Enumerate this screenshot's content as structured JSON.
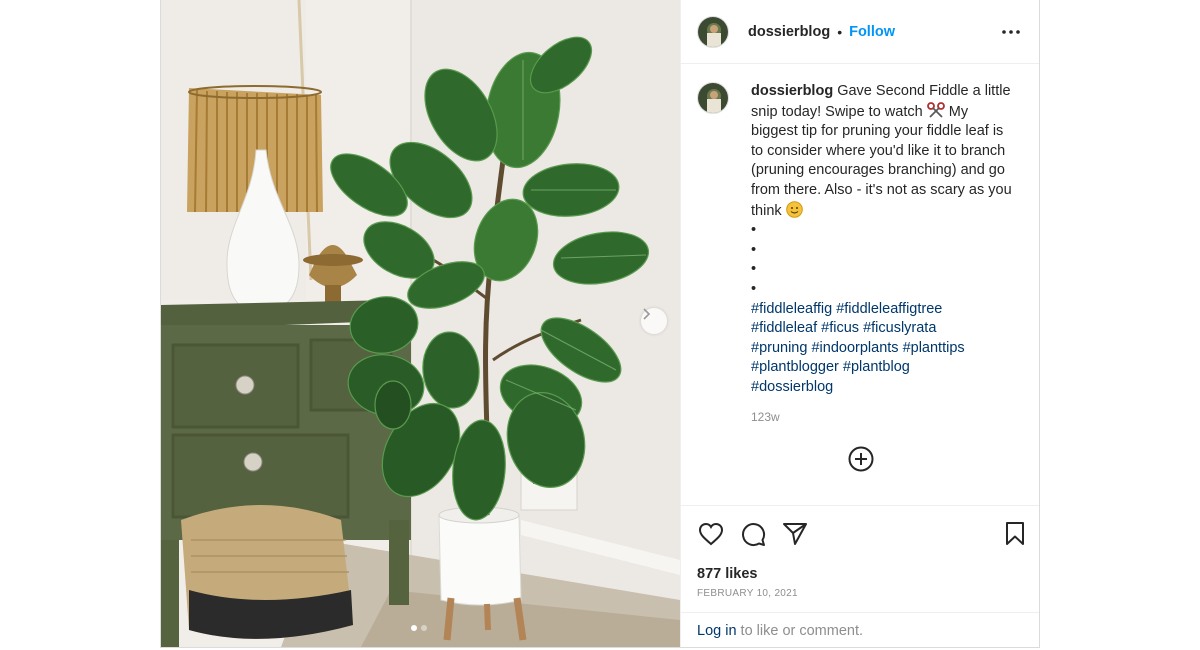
{
  "post": {
    "username": "dossierblog",
    "separator": "•",
    "follow_label": "Follow",
    "more_icon": "more-horizontal-icon",
    "caption": {
      "username": "dossierblog",
      "line1": "Gave Second Fiddle a little snip today! Swipe to watch",
      "emoji1": "scissors-emoji",
      "line2": "My biggest tip for pruning your fiddle leaf is to consider where you'd like it to branch (pruning encourages branching) and go from there. Also - it's not as scary as you think",
      "emoji2": "smiling-face-emoji",
      "dots": [
        "•",
        "•",
        "•",
        "•"
      ],
      "hashtags": [
        "#fiddleleaffig",
        "#fiddleleaffigtree",
        "#fiddleleaf",
        "#ficus",
        "#ficuslyrata",
        "#pruning",
        "#indoorplants",
        "#planttips",
        "#plantblogger",
        "#plantblog",
        "#dossierblog"
      ],
      "time_ago": "123w"
    },
    "likes": "877 likes",
    "date": "FEBRUARY 10, 2021",
    "login": {
      "link": "Log in",
      "rest": " to like or comment."
    },
    "carousel": {
      "total": 2,
      "active": 1
    }
  },
  "colors": {
    "accent": "#0095f6",
    "hashtag": "#00376b",
    "muted": "#8e8e8e",
    "border": "#dbdbdb"
  }
}
